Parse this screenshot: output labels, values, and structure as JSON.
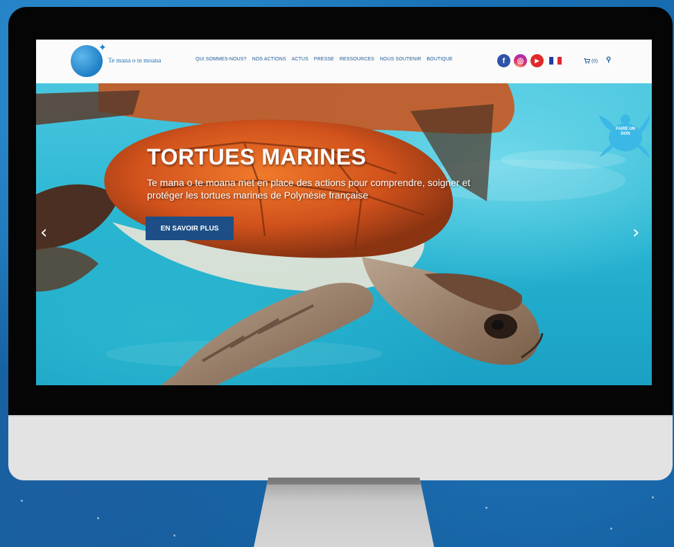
{
  "site": {
    "logo_text": "Te mana o te moana",
    "menu": [
      {
        "label": "QUI SOMMES-NOUS?"
      },
      {
        "label": "NOS ACTIONS"
      },
      {
        "label": "ACTUS"
      },
      {
        "label": "PRESSE"
      },
      {
        "label": "RESSOURCES"
      },
      {
        "label": "NOUS SOUTENIR"
      },
      {
        "label": "BOUTIQUE"
      }
    ],
    "socials": [
      {
        "icon": "facebook-icon",
        "glyph": "f"
      },
      {
        "icon": "instagram-icon",
        "glyph": "◎"
      },
      {
        "icon": "youtube-icon",
        "glyph": "▶"
      }
    ],
    "cart_label": "(0)",
    "donate_label": "FAIRE UN DON"
  },
  "hero": {
    "title": "TORTUES MARINES",
    "subtitle": "Te mana o te moana met en place des actions pour comprendre, soigner et protéger les tortues marines de Polynésie française",
    "button_label": "EN SAVOIR PLUS",
    "prev_arrow": "‹",
    "next_arrow": "›"
  },
  "colors": {
    "brand_blue": "#1d5a96",
    "button_blue": "#1d4f86",
    "logo_blue": "#1e7fc6",
    "turtle_shell": "#d9531e",
    "flag": [
      "#1f3fa8",
      "#ffffff",
      "#e0282d"
    ]
  }
}
